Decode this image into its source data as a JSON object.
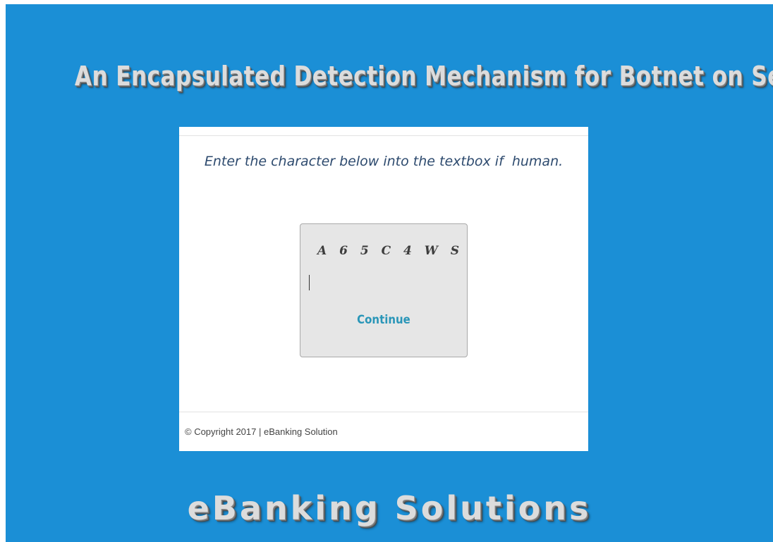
{
  "header": {
    "title": "An Encapsulated Detection Mechanism for Botnet on Server End"
  },
  "captcha_panel": {
    "instruction": "Enter the character below into the textbox if  human.",
    "captcha_code": "A 6 5 C 4 W S",
    "input_value": "",
    "continue_label": "Continue"
  },
  "footer": {
    "copyright": "© Copyright 2017 | eBanking Solution"
  },
  "brand": {
    "name": "eBanking Solutions"
  },
  "colors": {
    "background": "#1b8fd6",
    "panel": "#ffffff",
    "captcha_box": "#e6e6e6",
    "continue_link": "#2a96b8",
    "instruction_text": "#2d4a6e"
  }
}
